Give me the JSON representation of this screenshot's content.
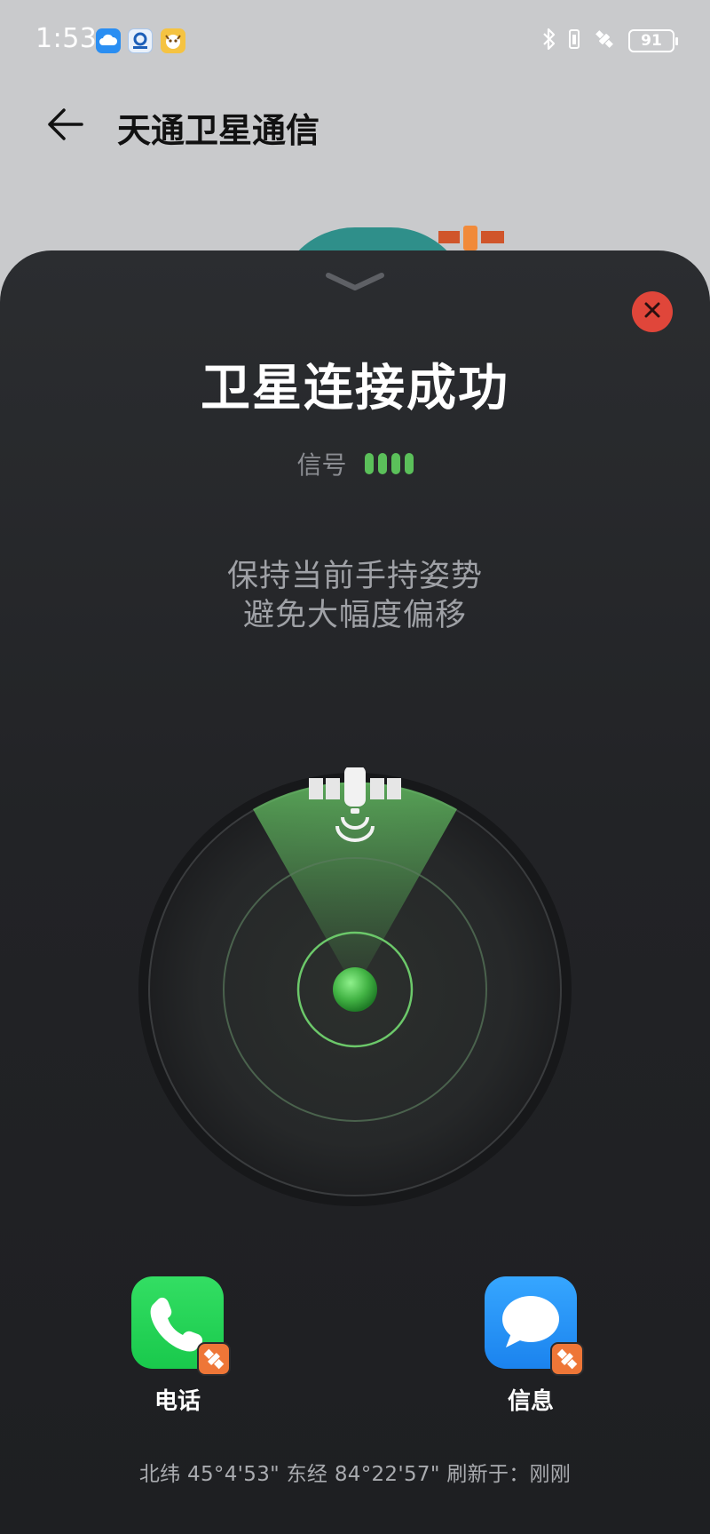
{
  "status_bar": {
    "time": "1:53",
    "battery": "91",
    "notification_icons": [
      "cloud-icon",
      "bank-app-icon",
      "pet-app-icon"
    ],
    "system_icons": [
      "bluetooth-icon",
      "satellite-icon",
      "battery-icon"
    ]
  },
  "header": {
    "title": "天通卫星通信"
  },
  "sheet": {
    "status_title": "卫星连接成功",
    "signal_label": "信号",
    "signal_level": 4,
    "signal_max": 4,
    "hint_line1": "保持当前手持姿势",
    "hint_line2": "避免大幅度偏移",
    "actions": [
      {
        "label": "电话",
        "icon": "phone-icon",
        "badge": "satellite-icon"
      },
      {
        "label": "信息",
        "icon": "message-icon",
        "badge": "satellite-icon"
      }
    ],
    "coords_text": "北纬 45°4'53\" 东经 84°22'57\" 刷新于：刚刚"
  },
  "colors": {
    "accent_green": "#5bc05a",
    "close_red": "#e0463a",
    "badge_orange": "#ee7637",
    "phone_green": "#1fcc50",
    "message_blue": "#2591f5"
  }
}
